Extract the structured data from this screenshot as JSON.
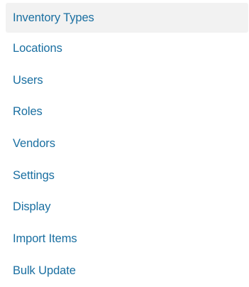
{
  "settings_nav": {
    "active_index": 0,
    "items": [
      {
        "label": "Inventory Types"
      },
      {
        "label": "Locations"
      },
      {
        "label": "Users"
      },
      {
        "label": "Roles"
      },
      {
        "label": "Vendors"
      },
      {
        "label": "Settings"
      },
      {
        "label": "Display"
      },
      {
        "label": "Import Items"
      },
      {
        "label": "Bulk Update"
      }
    ]
  },
  "colors": {
    "link": "#1a6fa1",
    "active_background": "#f2f2f2"
  }
}
